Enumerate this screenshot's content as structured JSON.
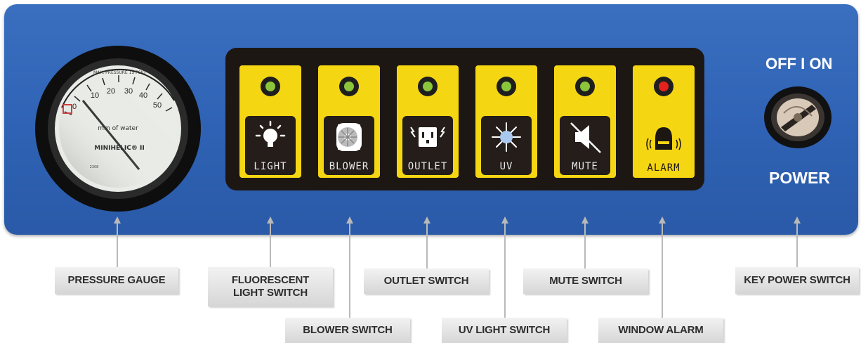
{
  "gauge": {
    "scale_numbers": [
      "0",
      "10",
      "20",
      "30",
      "40",
      "50"
    ],
    "top_text": "MAX. PRESSURE 15 PSIG",
    "unit_text": "mm of water",
    "brand_text": "MINIHELIC® II",
    "serial_text": "2308"
  },
  "switches": [
    {
      "label": "LIGHT",
      "led": "#8bc53a",
      "icon": "bulb-icon"
    },
    {
      "label": "BLOWER",
      "led": "#8bc53a",
      "icon": "blower-fan-icon"
    },
    {
      "label": "OUTLET",
      "led": "#8bc53a",
      "icon": "outlet-icon"
    },
    {
      "label": "UV",
      "led": "#8bc53a",
      "icon": "uv-sun-icon"
    },
    {
      "label": "MUTE",
      "led": "#8bc53a",
      "icon": "speaker-muted-icon"
    },
    {
      "label": "ALARM",
      "led": "#e3221d",
      "icon": "alarm-bell-icon"
    }
  ],
  "power": {
    "off_on": "OFF I ON",
    "power_label": "POWER"
  },
  "callouts": {
    "pressure_gauge": "PRESSURE GAUGE",
    "fluorescent_line1": "FLUORESCENT",
    "fluorescent_line2": "LIGHT SWITCH",
    "blower_switch": "BLOWER SWITCH",
    "outlet_switch": "OUTLET SWITCH",
    "uv_light_switch": "UV LIGHT SWITCH",
    "mute_switch": "MUTE SWITCH",
    "window_alarm": "WINDOW ALARM",
    "key_power_switch": "KEY POWER SWITCH"
  },
  "colors": {
    "panel_blue": "#2f62b4",
    "button_yellow": "#f5d612",
    "strip_black": "#1d1714",
    "led_green": "#8bc53a",
    "led_red": "#e3221d"
  }
}
